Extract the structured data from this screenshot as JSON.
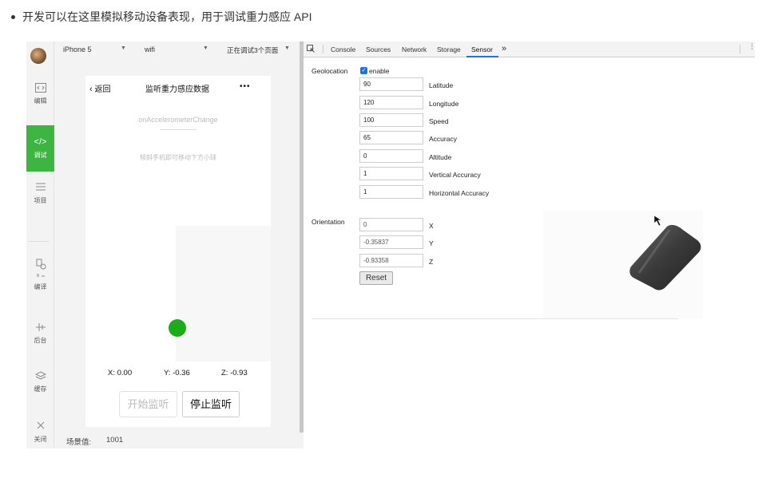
{
  "intro": {
    "text": "开发可以在这里模拟移动设备表现，用于调试重力感应 API"
  },
  "nav": {
    "edit": "编辑",
    "debug": "调试",
    "project": "项目",
    "compile": "编译",
    "background": "后台",
    "cache": "缓存",
    "close": "关闭"
  },
  "sim": {
    "device": "iPhone 5",
    "network": "wifi",
    "pages": "正在调试3个页面"
  },
  "phone": {
    "back": "返回",
    "title": "监听重力感应数据",
    "more": "•••",
    "event": "onAccelerometerChange",
    "hint": "倾斜手机即可移动下方小球",
    "x": "X: 0.00",
    "y": "Y: -0.36",
    "z": "Z: -0.93",
    "start": "开始监听",
    "stop": "停止监听"
  },
  "status": {
    "label": "场景值:",
    "value": "1001"
  },
  "devtools": {
    "tabs": [
      "Console",
      "Sources",
      "Network",
      "Storage",
      "Sensor"
    ],
    "more": "»",
    "geolocation": "Geolocation",
    "enable": "enable",
    "geo_fields": [
      {
        "value": "90",
        "label": "Latitude"
      },
      {
        "value": "120",
        "label": "Longitude"
      },
      {
        "value": "100",
        "label": "Speed"
      },
      {
        "value": "65",
        "label": "Accuracy"
      },
      {
        "value": "0",
        "label": "Altitude"
      },
      {
        "value": "1",
        "label": "Vertical Accuracy"
      },
      {
        "value": "1",
        "label": "Horizontal Accuracy"
      }
    ],
    "orientation": "Orientation",
    "ori_fields": [
      {
        "value": "0",
        "label": "X"
      },
      {
        "value": "-0.35837",
        "label": "Y"
      },
      {
        "value": "-0.93358",
        "label": "Z"
      }
    ],
    "reset": "Reset"
  },
  "colors": {
    "accent": "#3cb640",
    "ball": "#1aad19",
    "active_tab": "#1a73e8"
  }
}
